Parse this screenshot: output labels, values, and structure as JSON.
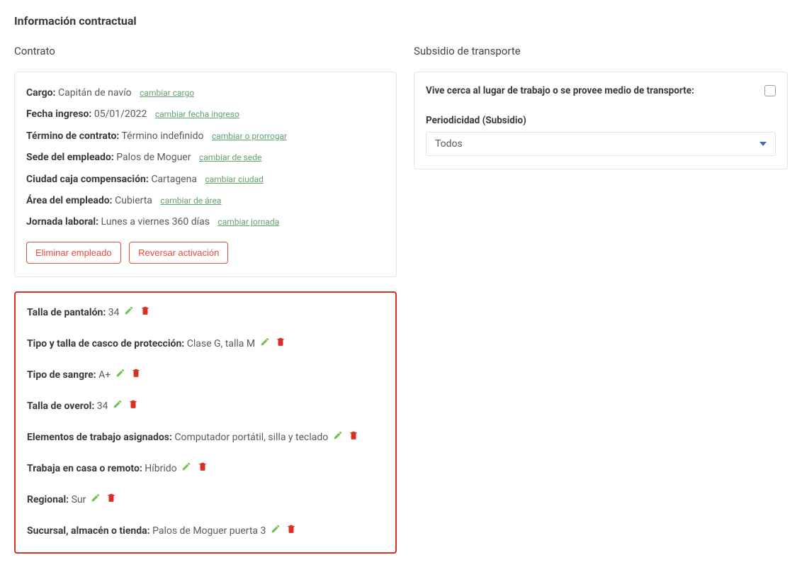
{
  "page": {
    "title": "Información contractual"
  },
  "contract": {
    "section_title": "Contrato",
    "rows": [
      {
        "label": "Cargo:",
        "value": "Capitán de navío",
        "link": "cambiar cargo"
      },
      {
        "label": "Fecha ingreso:",
        "value": "05/01/2022",
        "link": "cambiar fecha ingreso"
      },
      {
        "label": "Término de contrato:",
        "value": "Término indefinido",
        "link": "cambiar o prorrogar"
      },
      {
        "label": "Sede del empleado:",
        "value": "Palos de Moguer",
        "link": "cambiar de sede"
      },
      {
        "label": "Ciudad caja compensación:",
        "value": "Cartagena",
        "link": "cambiar ciudad"
      },
      {
        "label": "Área del empleado:",
        "value": "Cubierta",
        "link": "cambiar de área"
      },
      {
        "label": "Jornada laboral:",
        "value": "Lunes a viernes 360 días",
        "link": "cambiar jornada"
      }
    ],
    "buttons": {
      "delete_employee": "Eliminar empleado",
      "reverse_activation": "Reversar activación"
    }
  },
  "custom_fields": {
    "items": [
      {
        "label": "Talla de pantalón:",
        "value": "34"
      },
      {
        "label": "Tipo y talla de casco de protección:",
        "value": "Clase G, talla M"
      },
      {
        "label": "Tipo de sangre:",
        "value": "A+"
      },
      {
        "label": "Talla de overol:",
        "value": "34"
      },
      {
        "label": "Elementos de trabajo asignados:",
        "value": "Computador portátil, silla y teclado"
      },
      {
        "label": "Trabaja en casa o remoto:",
        "value": "Híbrido"
      },
      {
        "label": "Regional:",
        "value": "Sur"
      },
      {
        "label": "Sucursal, almacén o tienda:",
        "value": "Palos de Moguer puerta 3"
      }
    ]
  },
  "subsidy": {
    "section_title": "Subsidio de transporte",
    "near_work_label": "Vive cerca al lugar de trabajo o se provee medio de transporte:",
    "periodicity_label": "Periodicidad (Subsidio)",
    "periodicity_value": "Todos"
  },
  "colors": {
    "edit_icon": "#6cc24a",
    "trash_icon": "#d93025",
    "link_green": "#62a36e",
    "danger": "#e74c3c"
  }
}
